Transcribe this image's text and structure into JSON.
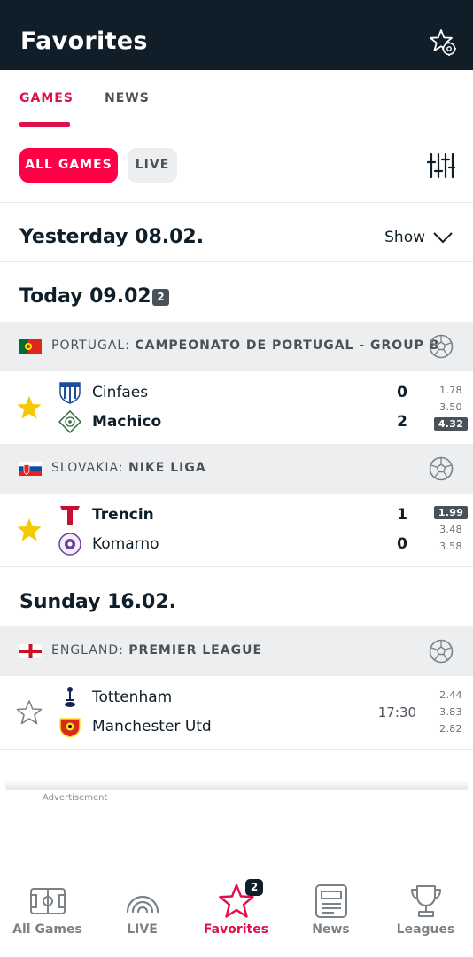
{
  "header": {
    "title": "Favorites",
    "settings_icon": "star-gear-icon"
  },
  "tabs": [
    {
      "label": "GAMES",
      "active": true
    },
    {
      "label": "NEWS",
      "active": false
    }
  ],
  "filters": {
    "all_games": "ALL GAMES",
    "live": "LIVE",
    "icon": "sliders-icon"
  },
  "yesterday": {
    "label": "Yesterday 08.02.",
    "show": "Show"
  },
  "today": {
    "label": "Today 09.02.",
    "count": "2",
    "leagues": [
      {
        "country": "PORTUGAL:",
        "name": "CAMPEONATO DE PORTUGAL - GROUP B",
        "match": {
          "favorite": true,
          "home": {
            "name": "Cinfaes",
            "score": "0",
            "winner": false
          },
          "away": {
            "name": "Machico",
            "score": "2",
            "winner": true
          },
          "odds": [
            "1.78",
            "3.50",
            "4.32"
          ],
          "highlighted_odd": 2
        }
      },
      {
        "country": "SLOVAKIA:",
        "name": "NIKE LIGA",
        "match": {
          "favorite": true,
          "home": {
            "name": "Trencin",
            "score": "1",
            "winner": true
          },
          "away": {
            "name": "Komarno",
            "score": "0",
            "winner": false
          },
          "odds": [
            "1.99",
            "3.48",
            "3.58"
          ],
          "highlighted_odd": 0
        }
      }
    ]
  },
  "sunday": {
    "label": "Sunday 16.02.",
    "league": {
      "country": "ENGLAND:",
      "name": "PREMIER LEAGUE",
      "match": {
        "favorite": false,
        "home": {
          "name": "Tottenham"
        },
        "away": {
          "name": "Manchester Utd"
        },
        "time": "17:30",
        "odds": [
          "2.44",
          "3.83",
          "2.82"
        ]
      }
    }
  },
  "ad": {
    "label": "Advertisement"
  },
  "bottom_nav": [
    {
      "label": "All Games",
      "icon": "pitch-icon"
    },
    {
      "label": "LIVE",
      "icon": "live-icon"
    },
    {
      "label": "Favorites",
      "icon": "star-icon",
      "badge": "2",
      "active": true
    },
    {
      "label": "News",
      "icon": "newspaper-icon"
    },
    {
      "label": "Leagues",
      "icon": "trophy-icon"
    }
  ],
  "colors": {
    "brand": "#e0104a",
    "header_bg": "#0f1e28",
    "star": "#f6c800",
    "pill": "#ff0046"
  }
}
